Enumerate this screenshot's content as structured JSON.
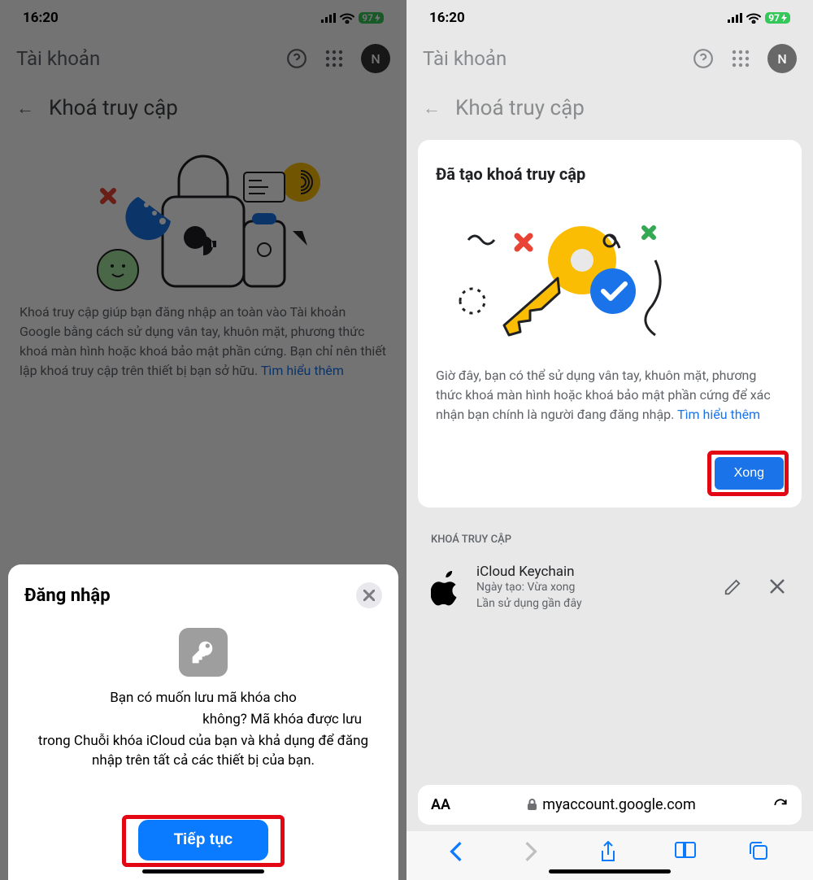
{
  "status": {
    "time": "16:20",
    "battery": "97"
  },
  "header": {
    "account": "Tài khoản",
    "avatar": "N"
  },
  "page": {
    "title": "Khoá truy cập"
  },
  "left": {
    "desc": "Khoá truy cập giúp bạn đăng nhập an toàn vào Tài khoản Google bằng cách sử dụng vân tay, khuôn mặt, phương thức khoá màn hình hoặc khoá bảo mật phần cứng. Bạn chỉ nên thiết lập khoá truy cập trên thiết bị bạn sở hữu. ",
    "learn_more": "Tìm hiểu thêm",
    "sheet": {
      "title": "Đăng nhập",
      "body_pre": "Bạn có muốn lưu mã khóa cho ",
      "body_post": " không? Mã khóa được lưu trong Chuỗi khóa iCloud của bạn và khả dụng để đăng nhập trên tất cả các thiết bị của bạn.",
      "button": "Tiếp tục"
    }
  },
  "right": {
    "card": {
      "title": "Đã tạo khoá truy cập",
      "desc": "Giờ đây, bạn có thể sử dụng vân tay, khuôn mặt, phương thức khoá màn hình hoặc khoá bảo mật phần cứng để xác nhận bạn chính là người đang đăng nhập. ",
      "learn_more": "Tìm hiểu thêm",
      "done": "Xong"
    },
    "section_label": "KHOÁ TRUY CẬP",
    "keychain": {
      "name": "iCloud Keychain",
      "created": "Ngày tạo: Vừa xong",
      "last_used": "Lần sử dụng gần đây"
    },
    "url": "myaccount.google.com",
    "aa": "AA"
  }
}
